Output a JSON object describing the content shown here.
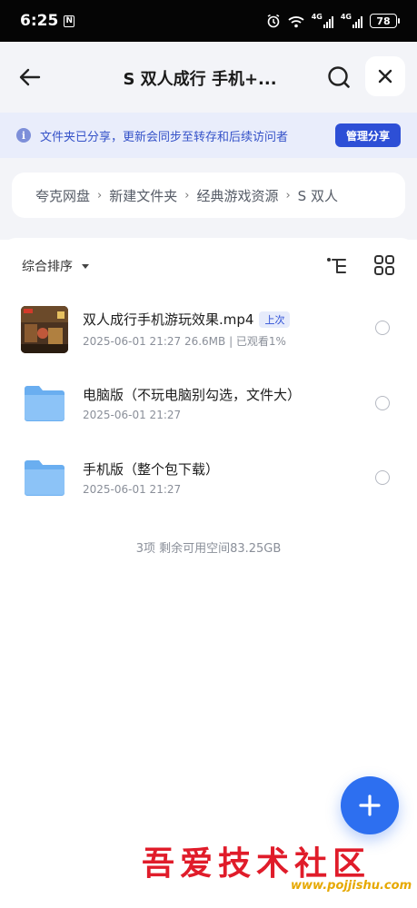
{
  "status_bar": {
    "time": "6:25",
    "nfc": "N",
    "network_1": "4G",
    "network_2": "4G",
    "battery": "78"
  },
  "header": {
    "title": "S 双人成行 手机+...",
    "back_icon": "back-arrow-icon",
    "search_icon": "search-icon",
    "close_icon": "close-icon"
  },
  "share_banner": {
    "message": "文件夹已分享，更新会同步至转存和后续访问者",
    "manage_label": "管理分享",
    "accent": "#2d4fd6"
  },
  "breadcrumb": {
    "items": [
      "夸克网盘",
      "新建文件夹",
      "经典游戏资源",
      "S 双人"
    ],
    "separator": "›"
  },
  "toolbar": {
    "sort_label": "综合排序"
  },
  "files": [
    {
      "type": "video",
      "name": "双人成行手机游玩效果.mp4",
      "badge": "上次",
      "meta": "2025-06-01 21:27  26.6MB | 已观看1%"
    },
    {
      "type": "folder",
      "name": "电脑版（不玩电脑别勾选，文件大）",
      "meta": "2025-06-01 21:27"
    },
    {
      "type": "folder",
      "name": "手机版（整个包下载）",
      "meta": "2025-06-01 21:27"
    }
  ],
  "footer": {
    "summary": "3项 剩余可用空间83.25GB"
  },
  "fab": {
    "icon": "plus-icon",
    "color": "#2d6ff0"
  },
  "watermark": {
    "title": "吾爱技术社区",
    "url": "www.pojjishu.com"
  }
}
